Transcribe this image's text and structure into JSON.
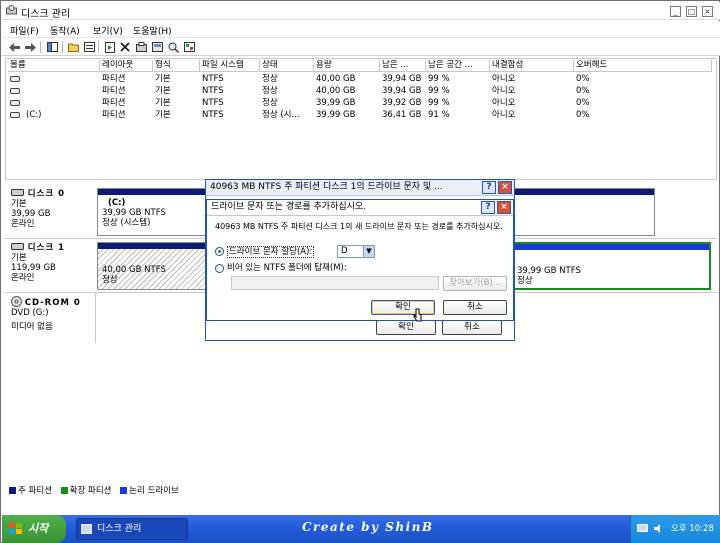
{
  "window": {
    "title": "디스크 관리"
  },
  "menu": [
    {
      "label": "파일(F)",
      "name": "menu-file"
    },
    {
      "label": "동작(A)",
      "name": "menu-action"
    },
    {
      "label": "보기(V)",
      "name": "menu-view"
    },
    {
      "label": "도움말(H)",
      "name": "menu-help"
    }
  ],
  "volumes": {
    "columns": [
      "볼륨",
      "레이아웃",
      "형식",
      "파일 시스템",
      "상태",
      "용량",
      "남은 ...",
      "남은 공간 ...",
      "내결함성",
      "오버헤드"
    ],
    "rows": [
      [
        "",
        "파티션",
        "기본",
        "NTFS",
        "정상",
        "40,00 GB",
        "39,94 GB",
        "99 %",
        "아니오",
        "0%"
      ],
      [
        "",
        "파티션",
        "기본",
        "NTFS",
        "정상",
        "40,00 GB",
        "39,94 GB",
        "99 %",
        "아니오",
        "0%"
      ],
      [
        "",
        "파티션",
        "기본",
        "NTFS",
        "정상",
        "39,99 GB",
        "39,92 GB",
        "99 %",
        "아니오",
        "0%"
      ],
      [
        "(C:)",
        "파티션",
        "기본",
        "NTFS",
        "정상 (시...",
        "39,99 GB",
        "36,41 GB",
        "91 %",
        "아니오",
        "0%"
      ]
    ]
  },
  "disks": {
    "disk0": {
      "name": "디스크 0",
      "type": "기본",
      "size": "39,99 GB",
      "status": "온라인",
      "part": {
        "label": "(C:)",
        "size": "39,99 GB NTFS",
        "status": "정상 (시스템)"
      }
    },
    "disk1": {
      "name": "디스크 1",
      "type": "기본",
      "size": "119,99 GB",
      "status": "온라인",
      "part1": {
        "size": "40,00 GB NTFS",
        "status": "정상"
      },
      "part2": {
        "size": "39,99 GB NTFS",
        "status": "정상"
      }
    },
    "cdrom0": {
      "name": "CD-ROM 0",
      "drive": "DVD (G:)",
      "status": "미디어 없음"
    }
  },
  "legend": [
    {
      "label": "주 파티션",
      "color": "#0a1b7a"
    },
    {
      "label": "확장 파티션",
      "color": "#1a8a1a"
    },
    {
      "label": "논리 드라이브",
      "color": "#1c3cd8"
    }
  ],
  "outer_dialog": {
    "title": "40963 MB NTFS 주 파티션 디스크 1의 드라이브 문자 및 ...",
    "ok": "확인",
    "cancel": "취소"
  },
  "inner_dialog": {
    "title": "드라이브 문자 또는 경로를 추가하십시오.",
    "description": "40963 MB NTFS 주 파티션 디스크 1의 새 드라이브 문자 또는 경로를 추가하십시오.",
    "option_assign": "드라이브 문자 할당(A):",
    "drive_letter": "D",
    "option_mount": "비어 있는 NTFS 폴더에 탑재(M):",
    "browse": "찾아보기(B)...",
    "ok": "확인",
    "cancel": "취소"
  },
  "taskbar": {
    "start": "시작",
    "task": "디스크 관리",
    "watermark": "Create by ShinB",
    "clock": "오후 10:28"
  }
}
